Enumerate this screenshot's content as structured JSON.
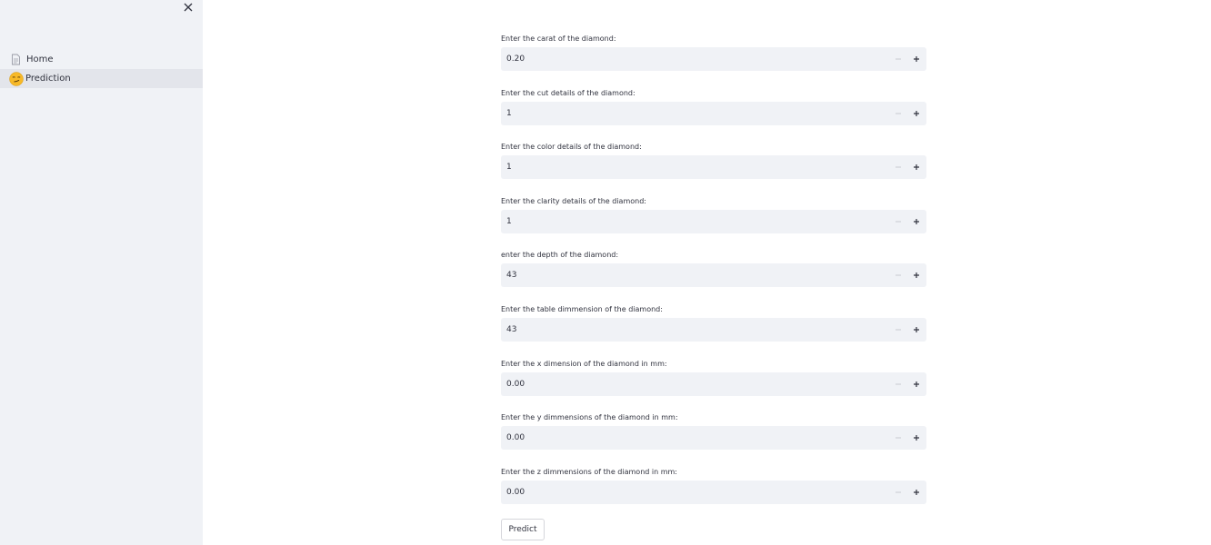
{
  "sidebar": {
    "close_icon": "close-icon",
    "nav": [
      {
        "label": "Home",
        "icon": "page-icon",
        "active": false
      },
      {
        "label": "Prediction",
        "icon": "smirk-emoji-icon",
        "active": true
      }
    ]
  },
  "form": {
    "fields": [
      {
        "label": "Enter the carat of the diamond:",
        "value": "0.20"
      },
      {
        "label": "Enter the cut details of the diamond:",
        "value": "1"
      },
      {
        "label": "Enter the color details of the diamond:",
        "value": "1"
      },
      {
        "label": "Enter the clarity details of the diamond:",
        "value": "1"
      },
      {
        "label": "enter the depth of the diamond:",
        "value": "43"
      },
      {
        "label": "Enter the table dimmension of the diamond:",
        "value": "43"
      },
      {
        "label": "Enter the x dimension of the diamond in mm:",
        "value": "0.00"
      },
      {
        "label": "Enter the y dimmensions of the diamond in mm:",
        "value": "0.00"
      },
      {
        "label": "Enter the z dimmensions of the diamond in mm:",
        "value": "0.00"
      }
    ],
    "predict_label": "Predict"
  },
  "colors": {
    "sidebar_bg": "#f0f2f6",
    "active_item_bg": "#e3e5eb",
    "input_bg": "#f0f2f6",
    "text": "#31333f",
    "disabled_icon": "#c7c9d0"
  }
}
